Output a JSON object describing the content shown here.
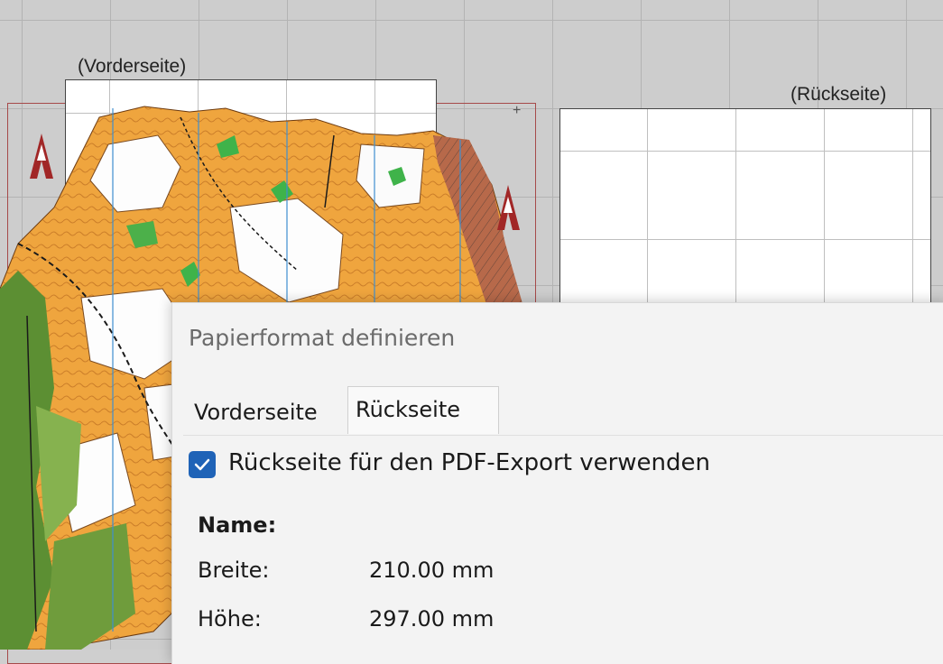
{
  "canvas": {
    "front_label": "(Vorderseite)",
    "back_label": "(Rückseite)",
    "crosshair_glyph": "+",
    "north_arrow_icon": "north-arrow-icon",
    "colors": {
      "grid": "#b3b3b3",
      "frame": "#a64a4a",
      "map_orange": "#f0a43a",
      "map_green": "#5f9a3a"
    }
  },
  "dialog": {
    "title": "Papierformat definieren",
    "tabs": [
      {
        "label": "Vorderseite",
        "selected": false
      },
      {
        "label": "Rückseite",
        "selected": true
      }
    ],
    "use_back_checkbox": {
      "label": "Rückseite für den PDF-Export verwenden",
      "checked": true,
      "check_icon": "checkmark-icon"
    },
    "fields": {
      "name_label": "Name:",
      "width_label": "Breite:",
      "width_value": "210.00 mm",
      "height_label": "Höhe:",
      "height_value": "297.00 mm"
    },
    "accent_color": "#1f63b7"
  }
}
